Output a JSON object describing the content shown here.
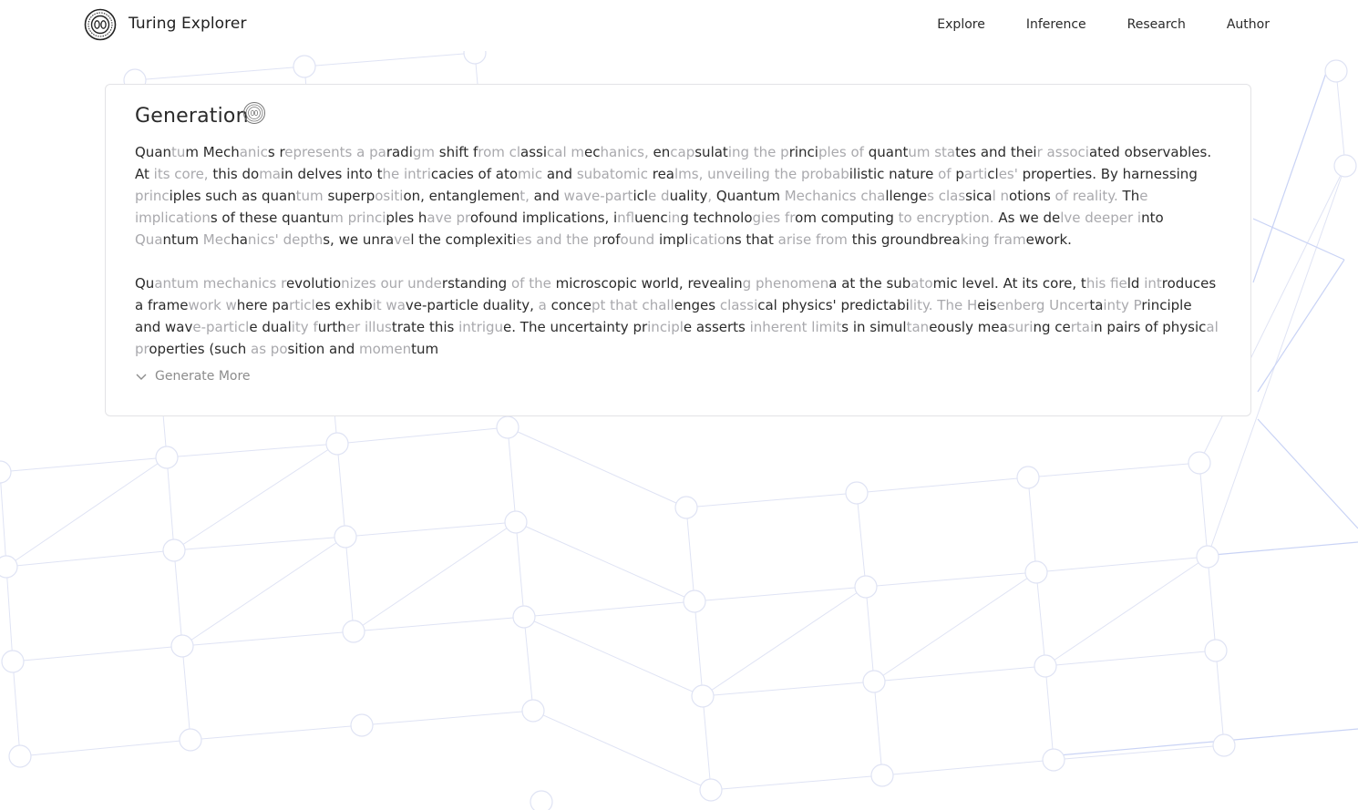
{
  "header": {
    "app_title": "Turing Explorer",
    "nav": [
      "Explore",
      "Inference",
      "Research",
      "Author"
    ]
  },
  "card": {
    "title": "Generation",
    "paragraphs": [
      "Quantum Mechanics represents a paradigm shift from classical mechanics, encapsulating the principles of quantum states and their associated observables. At its core, this domain delves into the intricacies of atomic and subatomic realms, unveiling the probabilistic nature of particles' properties. By harnessing principles such as quantum superposition, entanglement, and wave-particle duality, Quantum Mechanics challenges classical notions of reality. The implications of these quantum principles have profound implications, influencing technologies from computing to encryption. As we delve deeper into Quantum Mechanics' depths, we unravel the complexities and the profound implications that arise from this groundbreaking framework.",
      "Quantum mechanics revolutionizes our understanding of the microscopic world, revealing phenomena at the subatomic level. At its core, this field introduces a framework where particles exhibit wave-particle duality, a concept that challenges classical physics' predictability. The Heisenberg Uncertainty Principle and wave-particle duality further illustrate this intrigue. The uncertainty principle asserts inherent limits in simultaneously measuring certain pairs of physical properties (such as position and momentum"
    ],
    "generate_more_label": "Generate More"
  },
  "colors": {
    "text": "#2b2b2b",
    "faded_text": "#a9a9ad",
    "network_line": "#dfe3f4",
    "network_accent": "#c9d3f5"
  },
  "icons": [
    "turing-logo-icon",
    "generation-spiral-icon",
    "chevron-down-icon"
  ]
}
